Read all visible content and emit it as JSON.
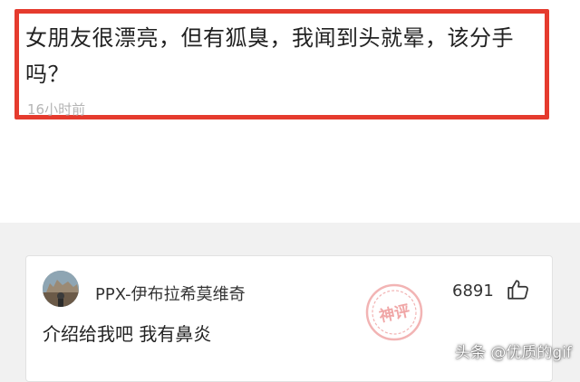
{
  "question": {
    "title": "女朋友很漂亮，但有狐臭，我闻到头就晕，该分手吗？",
    "time": "16小时前"
  },
  "comment": {
    "username": "PPX-伊布拉希莫维奇",
    "likes": "6891",
    "text": "介绍给我吧 我有鼻炎",
    "badge_text": "神评",
    "like_icon": "thumbs-up-icon",
    "badge_icon": "god-comment-stamp-icon"
  },
  "watermark": {
    "text": "头条 @优质的gif"
  },
  "colors": {
    "highlight_border": "#e53b2e",
    "stamp": "#f2b4b4",
    "page_background": "#f1f1f1"
  }
}
